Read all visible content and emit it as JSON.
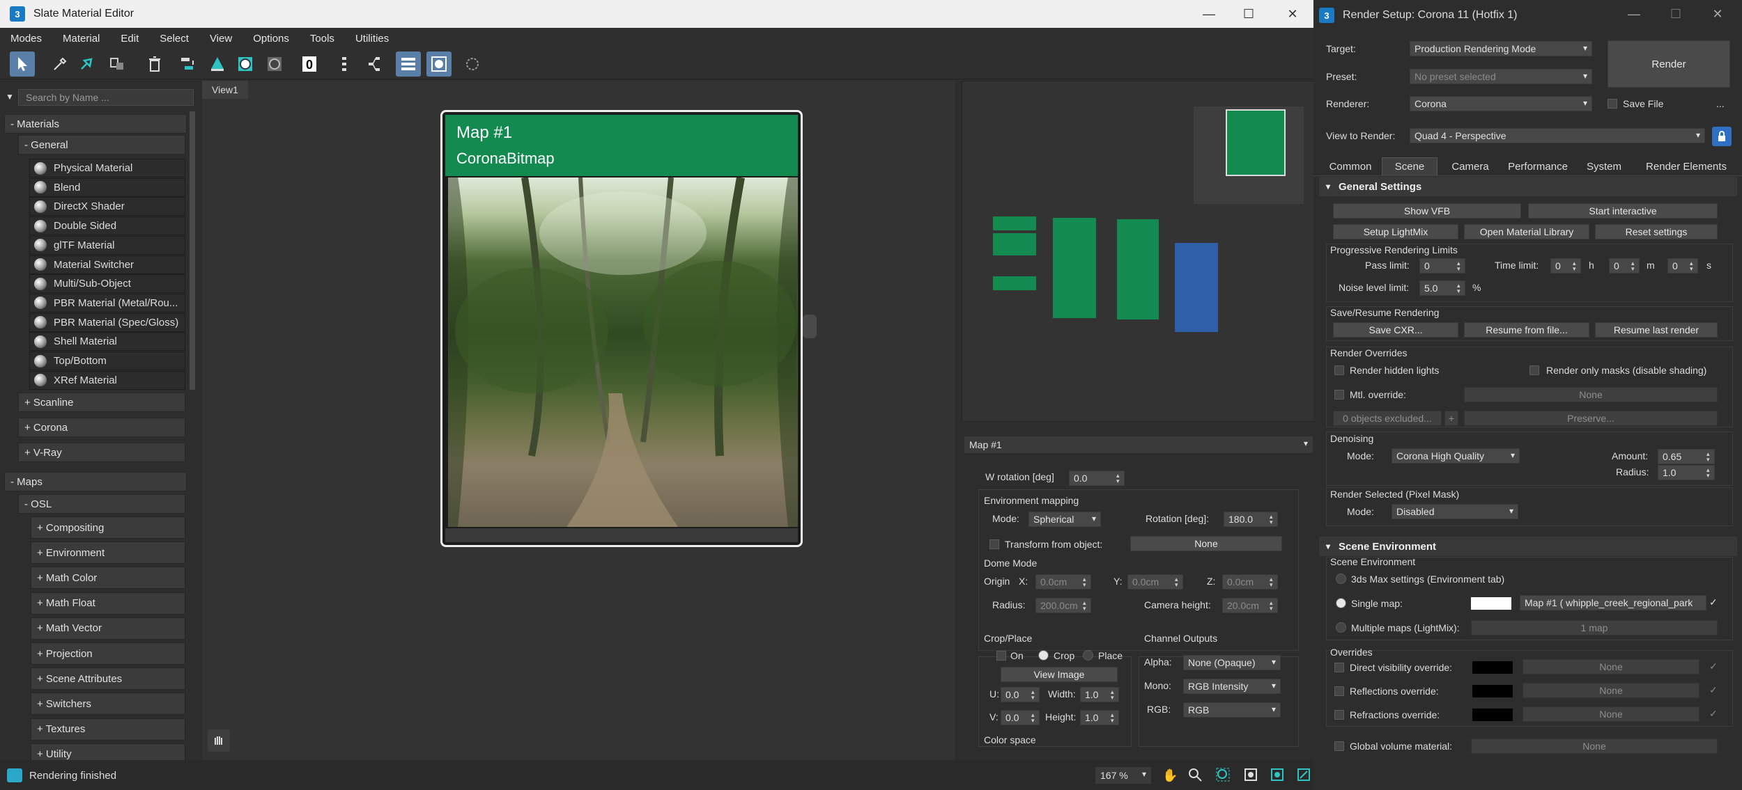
{
  "sme": {
    "title": "Slate Material Editor",
    "icon": "3",
    "menu": [
      "Modes",
      "Material",
      "Edit",
      "Select",
      "View",
      "Options",
      "Tools",
      "Utilities"
    ],
    "search_placeholder": "Search by Name ...",
    "materials_header": "- Materials",
    "general_header": "- General",
    "general_items": [
      "Physical Material",
      "Blend",
      "DirectX Shader",
      "Double Sided",
      "glTF Material",
      "Material Switcher",
      "Multi/Sub-Object",
      "PBR Material (Metal/Rou...",
      "PBR Material (Spec/Gloss)",
      "Shell Material",
      "Top/Bottom",
      "XRef Material"
    ],
    "other_groups": [
      "+ Scanline",
      "+ Corona",
      "+ V-Ray"
    ],
    "maps_header": "- Maps",
    "osl_header": "- OSL",
    "osl_items": [
      "+ Compositing",
      "+ Environment",
      "+ Math Color",
      "+ Math Float",
      "+ Math Vector",
      "+ Projection",
      "+ Scene Attributes",
      "+ Switchers",
      "+ Textures",
      "+ Utility"
    ],
    "view_tab": "View1",
    "node": {
      "title": "Map #1",
      "subtitle": "CoronaBitmap"
    },
    "status": "Rendering finished",
    "zoom": "167 %",
    "prop": {
      "header": "Map #1",
      "w_rotation_label": "W rotation [deg]",
      "w_rotation": "0.0",
      "env_mapping": "Environment mapping",
      "mode_label": "Mode:",
      "mode": "Spherical",
      "rotation_label": "Rotation [deg]:",
      "rotation": "180.0",
      "transform_label": "Transform from object:",
      "transform_value": "None",
      "dome_mode": "Dome Mode",
      "origin_label": "Origin",
      "x_label": "X:",
      "x": "0.0cm",
      "y_label": "Y:",
      "y": "0.0cm",
      "z_label": "Z:",
      "z": "0.0cm",
      "radius_label": "Radius:",
      "radius": "200.0cm",
      "cam_height_label": "Camera height:",
      "cam_height": "20.0cm",
      "crop_place": "Crop/Place",
      "on_label": "On",
      "crop_label": "Crop",
      "place_label": "Place",
      "view_image": "View Image",
      "u_label": "U:",
      "u": "0.0",
      "width_label": "Width:",
      "width": "1.0",
      "v_label": "V:",
      "v": "0.0",
      "height_label": "Height:",
      "height": "1.0",
      "channel_outputs": "Channel Outputs",
      "alpha_label": "Alpha:",
      "alpha": "None (Opaque)",
      "mono_label": "Mono:",
      "mono": "RGB Intensity",
      "rgb_label": "RGB:",
      "rgb": "RGB",
      "color_space": "Color space"
    }
  },
  "rs": {
    "title": "Render Setup: Corona 11 (Hotfix 1)",
    "icon": "3",
    "target_label": "Target:",
    "target": "Production Rendering Mode",
    "preset_label": "Preset:",
    "preset": "No preset selected",
    "renderer_label": "Renderer:",
    "renderer": "Corona",
    "save_file": "Save File",
    "dots": "...",
    "view_label": "View to Render:",
    "view": "Quad 4 - Perspective",
    "render_btn": "Render",
    "tabs": [
      "Common",
      "Scene",
      "Camera",
      "Performance",
      "System",
      "Render Elements"
    ],
    "general_settings": "General Settings",
    "show_vfb": "Show VFB",
    "start_interactive": "Start interactive",
    "setup_lightmix": "Setup LightMix",
    "open_lib": "Open Material Library",
    "reset": "Reset settings",
    "prog_limits": "Progressive Rendering Limits",
    "pass_limit_label": "Pass limit:",
    "pass_limit": "0",
    "time_limit_label": "Time limit:",
    "t_h": "0",
    "h": "h",
    "t_m": "0",
    "m": "m",
    "t_s": "0",
    "s": "s",
    "noise_label": "Noise level limit:",
    "noise": "5.0",
    "pct": "%",
    "save_resume": "Save/Resume Rendering",
    "save_cxr": "Save CXR...",
    "resume_file": "Resume from file...",
    "resume_last": "Resume last render",
    "overrides_title": "Render Overrides",
    "hidden_lights": "Render hidden lights",
    "only_masks": "Render only masks (disable shading)",
    "mtl_override": "Mtl. override:",
    "none": "None",
    "objects_excluded": "0 objects excluded...",
    "plus": "+",
    "preserve": "Preserve...",
    "denoising": "Denoising",
    "den_mode_label": "Mode:",
    "den_mode": "Corona High Quality",
    "amount_label": "Amount:",
    "amount": "0.65",
    "radius_label": "Radius:",
    "radius": "1.0",
    "render_selected": "Render Selected (Pixel Mask)",
    "rsel_mode_label": "Mode:",
    "rsel_mode": "Disabled",
    "scene_env_header": "Scene Environment",
    "scene_env": "Scene Environment",
    "max_settings": "3ds Max settings (Environment tab)",
    "single_map": "Single map:",
    "map_name": "Map #1 ( whipple_creek_regional_park",
    "multiple_maps": "Multiple maps (LightMix):",
    "one_map": "1 map",
    "overrides": "Overrides",
    "direct_vis": "Direct visibility override:",
    "reflections": "Reflections override:",
    "refractions": "Refractions override:",
    "global_volume": "Global volume material:",
    "accent": "#138a50"
  }
}
